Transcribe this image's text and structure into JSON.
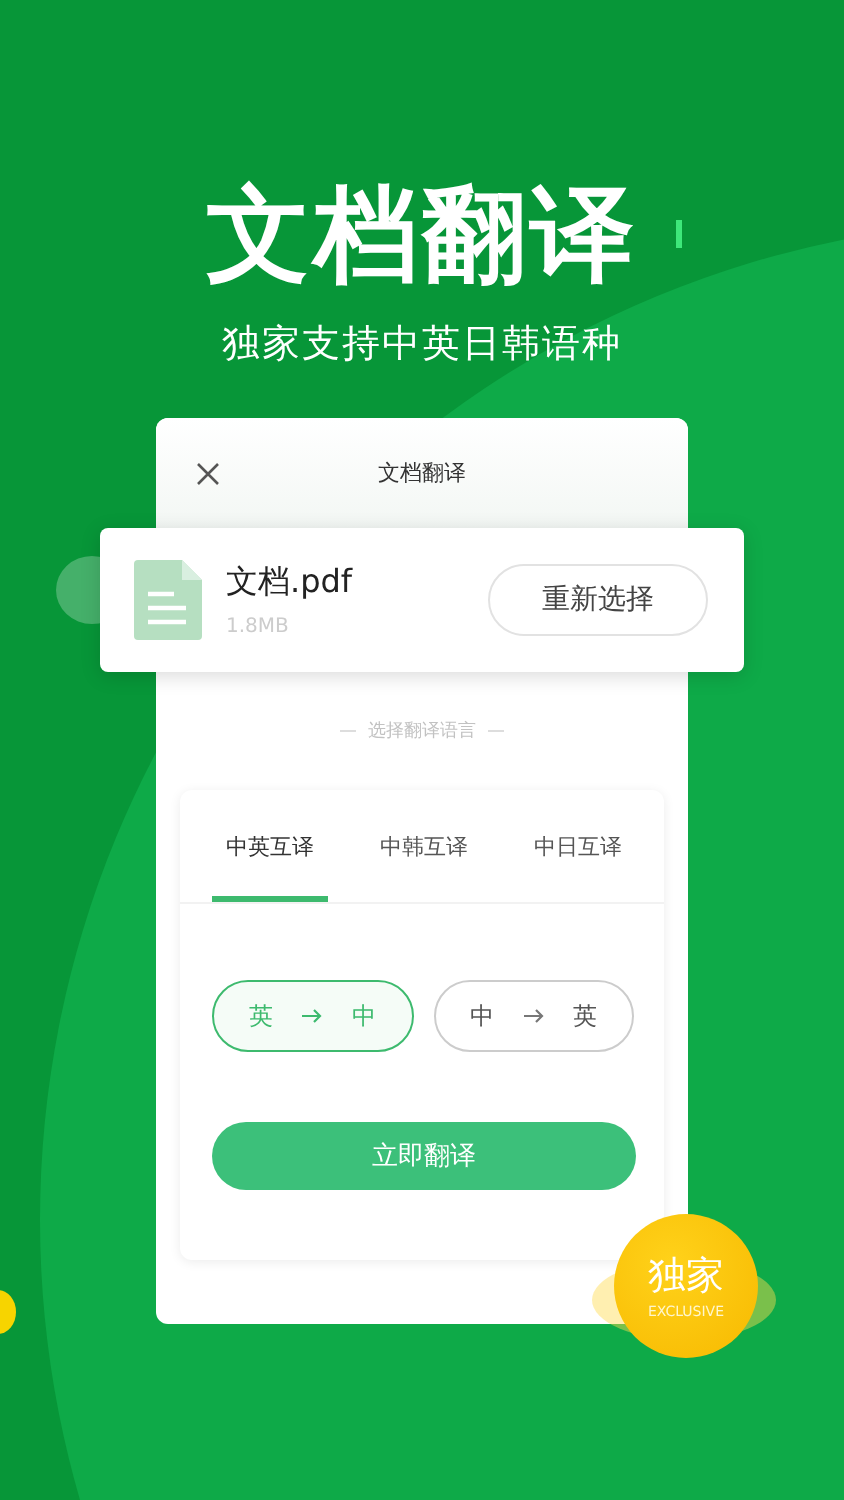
{
  "header": {
    "title": "文档翻译",
    "subtitle": "独家支持中英日韩语种"
  },
  "dialog": {
    "title": "文档翻译"
  },
  "file": {
    "name": "文档.pdf",
    "size": "1.8MB",
    "button": "重新选择"
  },
  "section_label": "选择翻译语言",
  "tabs": [
    {
      "label": "中英互译",
      "selected": true
    },
    {
      "label": "中韩互译",
      "selected": false
    },
    {
      "label": "中日互译",
      "selected": false
    }
  ],
  "directions": [
    {
      "from": "英",
      "to": "中",
      "selected": true
    },
    {
      "from": "中",
      "to": "英",
      "selected": false
    }
  ],
  "translate_button": "立即翻译",
  "badge": {
    "label": "独家",
    "sublabel": "EXCLUSIVE"
  }
}
